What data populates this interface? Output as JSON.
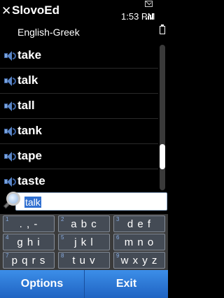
{
  "status_bar": {
    "app_title": "SlovoEd",
    "dictionary": "English-Greek",
    "time": "1:53 PM"
  },
  "word_list": [
    {
      "word": "take"
    },
    {
      "word": "talk"
    },
    {
      "word": "tall"
    },
    {
      "word": "tank"
    },
    {
      "word": "tape"
    },
    {
      "word": "taste"
    }
  ],
  "search": {
    "value": "talk"
  },
  "keypad": [
    {
      "num": "1",
      "label": ". , -"
    },
    {
      "num": "2",
      "label": "a b c"
    },
    {
      "num": "3",
      "label": "d e f"
    },
    {
      "num": "4",
      "label": "g h i"
    },
    {
      "num": "5",
      "label": "j k l"
    },
    {
      "num": "6",
      "label": "m n o"
    },
    {
      "num": "7",
      "label": "p q r s"
    },
    {
      "num": "8",
      "label": "t u v"
    },
    {
      "num": "9",
      "label": "w x y z"
    }
  ],
  "softkeys": {
    "left": "Options",
    "right": "Exit"
  },
  "colors": {
    "accent": "#2f6fd0",
    "softkey_bar": "#2b79d8",
    "key_bg": "#444b55"
  }
}
